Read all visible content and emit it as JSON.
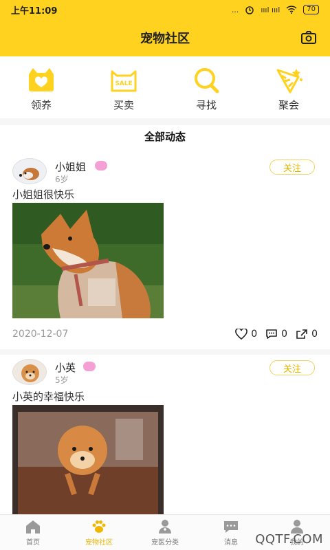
{
  "status_bar": {
    "time": "上午11:09",
    "dots": "...",
    "signal": "ıııl ıııl",
    "battery": "70"
  },
  "header": {
    "title": "宠物社区"
  },
  "quick_nav": [
    {
      "label": "领养",
      "icon": "adopt-house-heart-icon"
    },
    {
      "label": "买卖",
      "icon": "sale-cat-icon"
    },
    {
      "label": "寻找",
      "icon": "search-icon"
    },
    {
      "label": "聚会",
      "icon": "party-popper-icon"
    }
  ],
  "section_title": "全部动态",
  "posts": [
    {
      "name": "小姐姐",
      "age": "6岁",
      "follow_label": "关注",
      "text": "小姐姐很快乐",
      "date": "2020-12-07",
      "likes": "0",
      "comments": "0",
      "shares": "0"
    },
    {
      "name": "小英",
      "age": "5岁",
      "follow_label": "关注",
      "text": "小英的幸福快乐"
    }
  ],
  "tabbar": [
    {
      "label": "首页",
      "icon": "home-icon"
    },
    {
      "label": "宠物社区",
      "icon": "paw-icon"
    },
    {
      "label": "宠医分类",
      "icon": "vet-doctor-icon"
    },
    {
      "label": "消息",
      "icon": "message-icon"
    },
    {
      "label": "我的",
      "icon": "user-icon"
    }
  ],
  "watermark": "QQTF.COM",
  "colors": {
    "accent": "#ffd21f",
    "follow": "#e0b400",
    "badge": "#f4a0d4"
  }
}
